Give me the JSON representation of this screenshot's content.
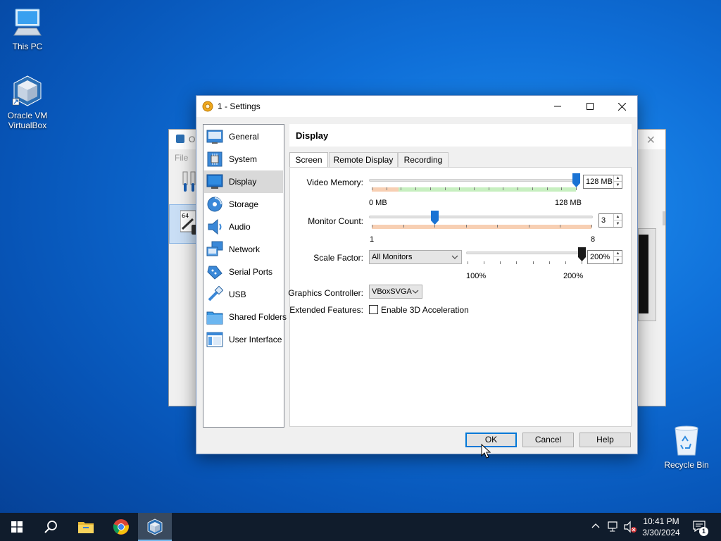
{
  "desktop": {
    "icons": [
      {
        "label": "This PC"
      },
      {
        "label": "Oracle VM VirtualBox"
      },
      {
        "label": "Recycle Bin"
      }
    ]
  },
  "background_window": {
    "title_partial": "O",
    "menu_partial": "File"
  },
  "dialog": {
    "title": "1 - Settings",
    "nav": [
      {
        "label": "General",
        "icon": "general-icon"
      },
      {
        "label": "System",
        "icon": "system-icon"
      },
      {
        "label": "Display",
        "icon": "display-icon",
        "active": true
      },
      {
        "label": "Storage",
        "icon": "storage-icon"
      },
      {
        "label": "Audio",
        "icon": "audio-icon"
      },
      {
        "label": "Network",
        "icon": "network-icon"
      },
      {
        "label": "Serial Ports",
        "icon": "serial-ports-icon"
      },
      {
        "label": "USB",
        "icon": "usb-icon"
      },
      {
        "label": "Shared Folders",
        "icon": "shared-folders-icon"
      },
      {
        "label": "User Interface",
        "icon": "user-interface-icon"
      }
    ],
    "section_title": "Display",
    "tabs": [
      {
        "label": "Screen",
        "active": true
      },
      {
        "label": "Remote Display"
      },
      {
        "label": "Recording"
      }
    ],
    "screen": {
      "video_memory": {
        "label": "Video Memory:",
        "value": "128 MB",
        "min_label": "0 MB",
        "max_label": "128 MB",
        "fraction": 1.0
      },
      "monitor_count": {
        "label": "Monitor Count:",
        "value": "3",
        "min_label": "1",
        "max_label": "8",
        "fraction": 0.2857
      },
      "scale_factor": {
        "label": "Scale Factor:",
        "combo_value": "All Monitors",
        "value": "200%",
        "min_label": "100%",
        "max_label": "200%",
        "fraction": 1.0
      },
      "graphics_controller": {
        "label": "Graphics Controller:",
        "value": "VBoxSVGA"
      },
      "extended_features": {
        "label": "Extended Features:",
        "checkbox_label": "Enable 3D Acceleration",
        "checked": false
      }
    },
    "buttons": {
      "ok": "OK",
      "cancel": "Cancel",
      "help": "Help"
    }
  },
  "taskbar": {
    "time": "10:41 PM",
    "date": "3/30/2024",
    "notification_count": "1"
  },
  "colors": {
    "accent": "#0078d7",
    "slider_thumb": "#1a73d4",
    "band_green": "#c7efc0",
    "band_red": "#f7cfb3"
  }
}
